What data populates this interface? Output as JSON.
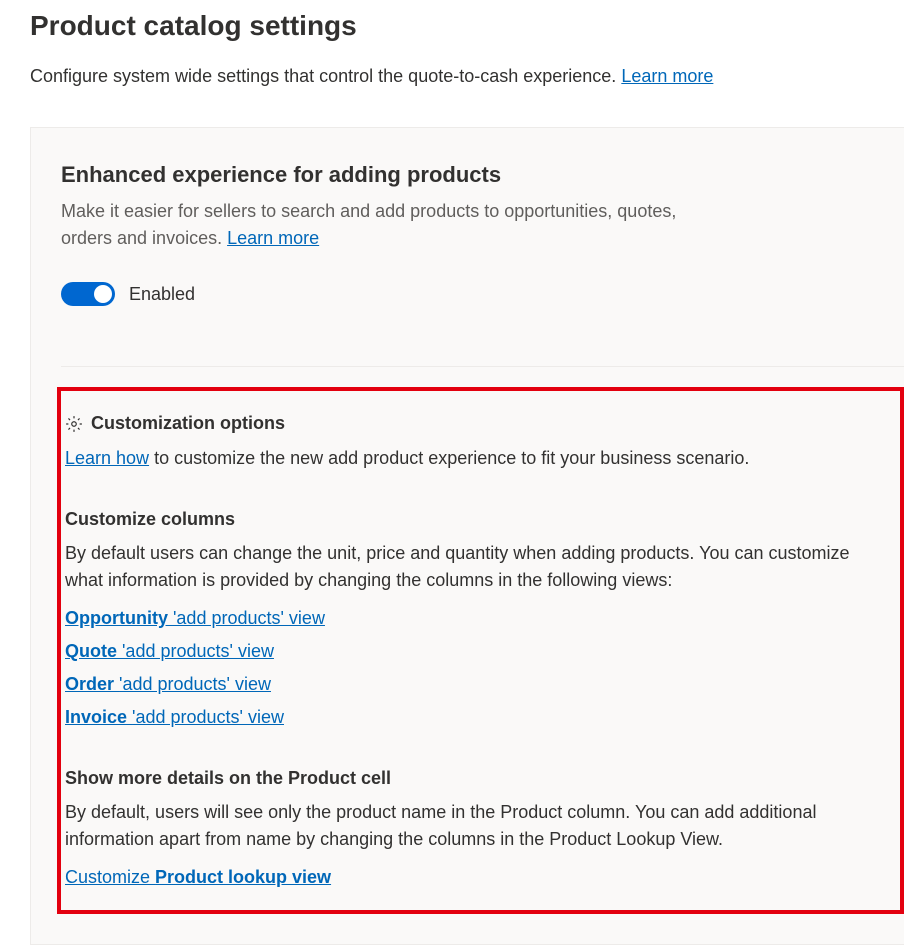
{
  "header": {
    "title": "Product catalog settings",
    "subtitle": "Configure system wide settings that control the quote-to-cash experience. ",
    "learn_more": "Learn more"
  },
  "enhanced": {
    "title": "Enhanced experience for adding products",
    "description_pre": "Make it easier for sellers to search and add products to opportunities, quotes, orders and invoices. ",
    "learn_more": "Learn more",
    "toggle_state": "Enabled"
  },
  "customization": {
    "heading": "Customization options",
    "learn_how": "Learn how",
    "description_after": " to customize the new add product experience to fit your business scenario.",
    "columns": {
      "heading": "Customize columns",
      "description": "By default users can change the unit, price and quantity when adding products. You can customize what information is provided by changing the columns in the following views:",
      "views": [
        {
          "bold": "Opportunity ",
          "rest": "'add products' view"
        },
        {
          "bold": "Quote ",
          "rest": "'add products' view"
        },
        {
          "bold": "Order ",
          "rest": "'add products' view"
        },
        {
          "bold": "Invoice ",
          "rest": "'add products' view"
        }
      ]
    },
    "product_cell": {
      "heading": "Show more details on the Product cell",
      "description": "By default, users will see only the product name in the Product column. You can add additional information apart from name by changing the columns in the Product Lookup View.",
      "link_pre": "Customize ",
      "link_bold": "Product lookup view"
    }
  }
}
